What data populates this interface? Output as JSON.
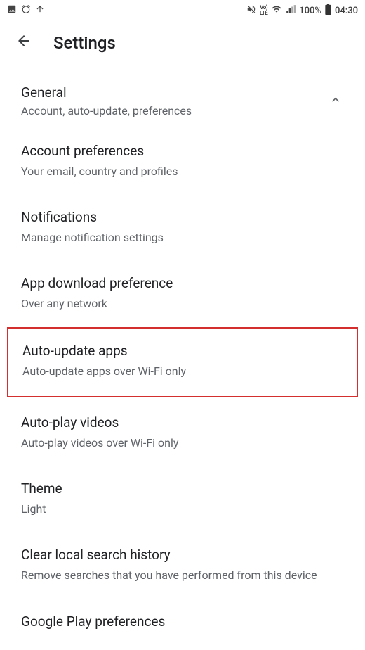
{
  "status_bar": {
    "mute_icon": "vibrate-mute-icon",
    "volte_label": "VoLTE",
    "battery_pct": "100%",
    "time": "04:30"
  },
  "header": {
    "title": "Settings"
  },
  "section": {
    "title": "General",
    "subtitle": "Account, auto-update, preferences"
  },
  "items": [
    {
      "title": "Account preferences",
      "subtitle": "Your email, country and profiles"
    },
    {
      "title": "Notifications",
      "subtitle": "Manage notification settings"
    },
    {
      "title": "App download preference",
      "subtitle": "Over any network"
    },
    {
      "title": "Auto-update apps",
      "subtitle": "Auto-update apps over Wi-Fi only"
    },
    {
      "title": "Auto-play videos",
      "subtitle": "Auto-play videos over Wi-Fi only"
    },
    {
      "title": "Theme",
      "subtitle": "Light"
    },
    {
      "title": "Clear local search history",
      "subtitle": "Remove searches that you have performed from this device"
    },
    {
      "title": "Google Play preferences",
      "subtitle": ""
    }
  ]
}
